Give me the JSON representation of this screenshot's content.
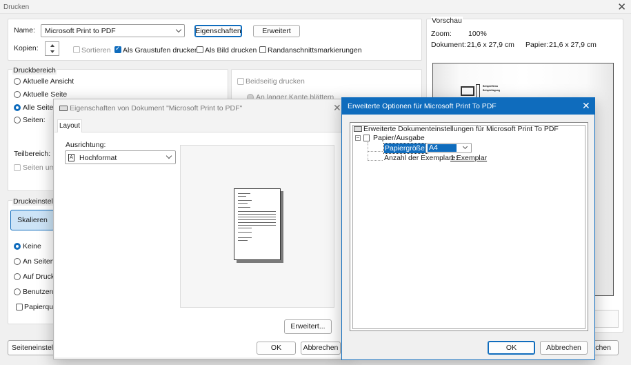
{
  "main": {
    "title": "Drucken",
    "name_label": "Name:",
    "printer": "Microsoft Print to PDF",
    "properties_button": "Eigenschaften",
    "advanced_button": "Erweitert",
    "copies_label": "Kopien:",
    "collate_label": "Sortieren",
    "grayscale_label": "Als Graustufen drucken",
    "as_image_label": "Als Bild drucken",
    "crop_marks_label": "Randanschnittsmarkierungen",
    "range_title": "Druckbereich",
    "range_current_view": "Aktuelle Ansicht",
    "range_current_page": "Aktuelle Seite",
    "range_all_pages": "Alle Seiten",
    "range_pages": "Seiten:",
    "subset_label": "Teilbereich:",
    "reverse_pages": "Seiten uml",
    "duplex_label": "Beidseitig drucken",
    "long_edge_label": "An langer Kante blättern",
    "settings_title": "Druckeinstellu",
    "scale_tab": "Skalieren",
    "scale_none": "Keine",
    "scale_fit": "An Seitenr",
    "scale_print": "Auf Druck",
    "scale_custom": "Benutzerd",
    "paper_source": "Papierque",
    "page_setup_button": "Seiteneinstellu",
    "cancel_fragment": "chen",
    "preview_title": "Vorschau",
    "zoom_label": "Zoom:",
    "zoom_value": "100%",
    "document_label": "Dokument:",
    "document_size": "21,6 x 27,9 cm",
    "paper_label": "Papier:",
    "paper_size": "21,6 x 27,9 cm",
    "preview_doc_line1": "Beispielfirma",
    "preview_doc_line2": "Beispieltagung"
  },
  "properties": {
    "title": "Eigenschaften von Dokument \"Microsoft Print to PDF\"",
    "tab_layout": "Layout",
    "orientation_label": "Ausrichtung:",
    "orientation_value": "Hochformat",
    "advanced_button": "Erweitert...",
    "ok_button": "OK",
    "cancel_button": "Abbrechen"
  },
  "advanced": {
    "title": "Erweiterte Optionen für Microsoft Print To PDF",
    "tree_root": "Erweiterte Dokumenteinstellungen für Microsoft Print To PDF",
    "tree_paper": "Papier/Ausgabe",
    "paper_size_label": "Papiergröße:",
    "paper_size_value": "A4",
    "copies_label": "Anzahl der Exemplare:",
    "copies_value": "1 Exemplar",
    "ok_button": "OK",
    "cancel_button": "Abbrechen"
  },
  "colors": {
    "accent": "#0f6cbd",
    "titlebar_active": "#0f6cbd"
  }
}
